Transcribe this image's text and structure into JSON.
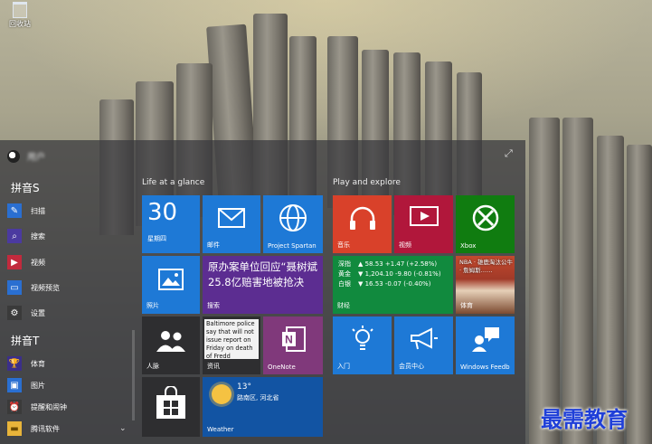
{
  "desktop": {
    "icon_label": "回收站",
    "watermark": "最需教育"
  },
  "start_menu": {
    "user_name": "用户",
    "groups": [
      {
        "header": "拼音S",
        "apps": [
          {
            "label": "扫描",
            "icon": "scan-icon",
            "color": "#2a6fd1"
          },
          {
            "label": "搜索",
            "icon": "search-icon",
            "color": "#4b3aa0"
          },
          {
            "label": "视频",
            "icon": "video-icon",
            "color": "#c22a3d"
          },
          {
            "label": "视频预览",
            "icon": "video-preview-icon",
            "color": "#2a6fd1"
          },
          {
            "label": "设置",
            "icon": "gear-icon",
            "color": "#3a3a3a"
          }
        ]
      },
      {
        "header": "拼音T",
        "apps": [
          {
            "label": "体育",
            "icon": "trophy-icon",
            "color": "#3b2f8a"
          },
          {
            "label": "图片",
            "icon": "photos-icon",
            "color": "#2a6fd1"
          },
          {
            "label": "提醒和闹钟",
            "icon": "alarm-icon",
            "color": "#3a3a3a"
          },
          {
            "label": "腾讯软件",
            "icon": "folder-icon",
            "color": "#e8b43a"
          }
        ]
      }
    ],
    "sections": {
      "life": "Life at a glance",
      "play": "Play and explore"
    },
    "tiles": {
      "calendar": {
        "day_number": "30",
        "weekday": "星期四"
      },
      "mail": {
        "label": "邮件"
      },
      "spartan": {
        "label": "Project Spartan"
      },
      "photos": {
        "label": "照片"
      },
      "search_news": {
        "text": "原办案单位回应“聂树斌25.8亿赔害地被抢决",
        "label": "搜索"
      },
      "people": {
        "label": "人脉"
      },
      "news": {
        "text": "Baltimore police say that will not issue report on Friday on death of Fredd",
        "label": "资讯"
      },
      "onenote": {
        "label": "OneNote"
      },
      "store": {
        "label": ""
      },
      "weather": {
        "temp": "13°",
        "location": "路南区, 河北省",
        "label": "Weather"
      },
      "music": {
        "label": "音乐"
      },
      "video": {
        "label": "视频"
      },
      "xbox": {
        "label": "Xbox"
      },
      "finance": {
        "label": "财经",
        "rows": [
          {
            "name": "深指",
            "value": "▲ 58.53 +1.47 (+2.58%)"
          },
          {
            "name": "黄金",
            "value": "▼ 1,204.10 -9.80 (-0.81%)"
          },
          {
            "name": "白银",
            "value": "▼ 16.53 -0.07 (-0.40%)"
          }
        ]
      },
      "sports": {
        "headline": "NBA · 雄鹿淘汰公牛 · 詹姆斯……",
        "label": "体育"
      },
      "getstarted": {
        "label": "入门"
      },
      "insider": {
        "label": "会员中心"
      },
      "feedback": {
        "label": "Windows Feedb"
      }
    },
    "colors": {
      "blue": "#1e79d6",
      "purple": "#5c2d91",
      "red": "#c0392b",
      "green": "#107c10",
      "dark": "#2e2e30",
      "darkblue": "#1254a3"
    }
  }
}
